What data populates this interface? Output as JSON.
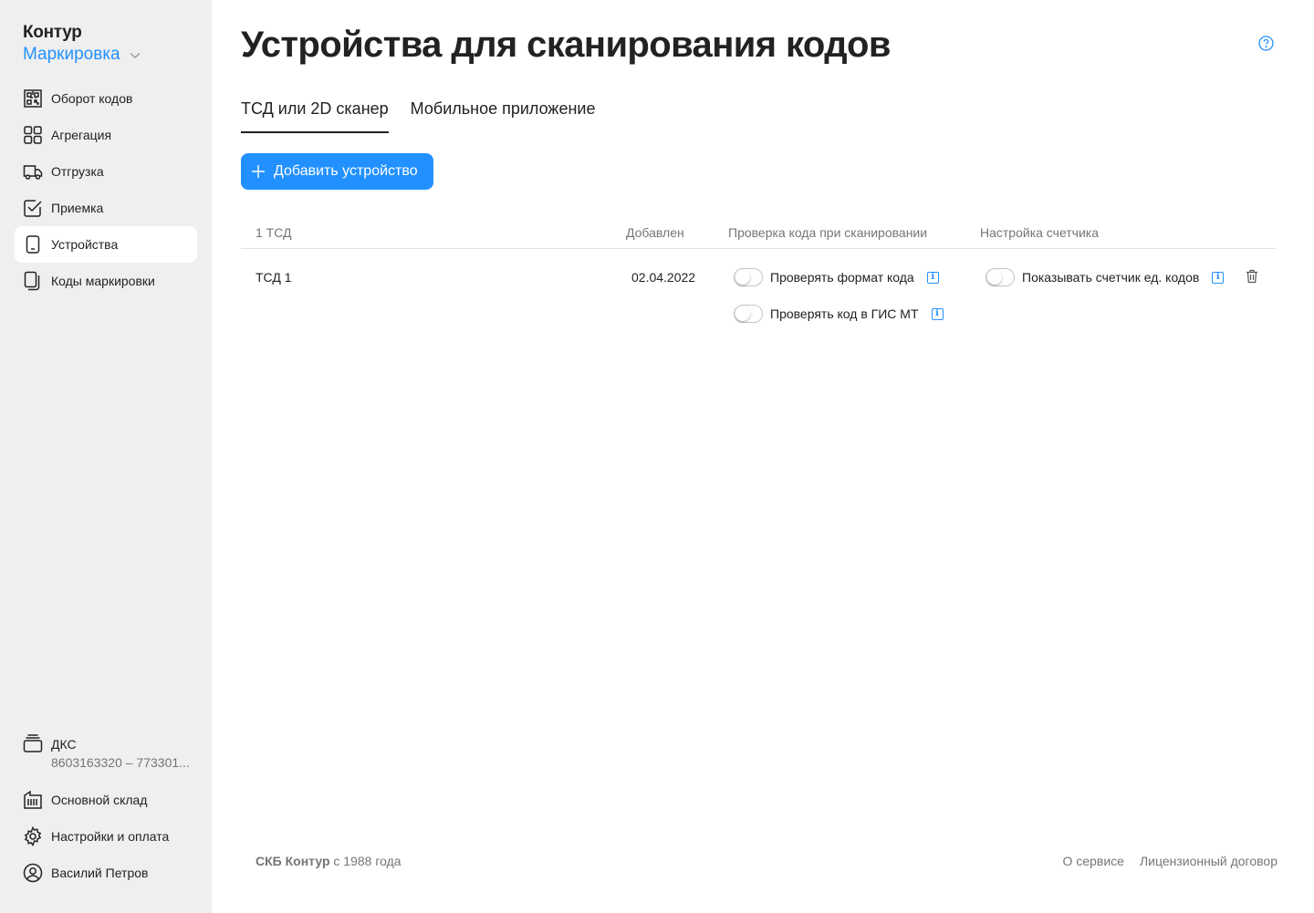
{
  "brand": {
    "top": "Контур",
    "product": "Маркировка"
  },
  "sidebar": {
    "items": [
      {
        "label": "Оборот кодов",
        "icon": "qr-code-icon"
      },
      {
        "label": "Агрегация",
        "icon": "grid-icon"
      },
      {
        "label": "Отгрузка",
        "icon": "truck-icon"
      },
      {
        "label": "Приемка",
        "icon": "checkbox-icon"
      },
      {
        "label": "Устройства",
        "icon": "device-icon",
        "active": true
      },
      {
        "label": "Коды маркировки",
        "icon": "copy-icon"
      }
    ],
    "org": {
      "name": "ДКС",
      "inn": "8603163320 – 773301..."
    },
    "bottom": [
      {
        "label": "Основной склад",
        "icon": "warehouse-icon"
      },
      {
        "label": "Настройки и оплата",
        "icon": "gear-icon"
      },
      {
        "label": "Василий Петров",
        "icon": "user-icon"
      }
    ]
  },
  "main": {
    "title": "Устройства для сканирования кодов",
    "tabs": [
      {
        "label": "ТСД или 2D сканер",
        "active": true
      },
      {
        "label": "Мобильное приложение",
        "active": false
      }
    ],
    "add_button": "Добавить устройство",
    "table": {
      "headers": {
        "name": "1 ТСД",
        "added": "Добавлен",
        "check": "Проверка кода при сканировании",
        "counter": "Настройка счетчика"
      },
      "rows": [
        {
          "name": "ТСД 1",
          "added": "02.04.2022",
          "check_format": "Проверять формат кода",
          "check_gis": "Проверять код в ГИС МТ",
          "show_counter": "Показывать счетчик ед. кодов"
        }
      ]
    }
  },
  "footer": {
    "company": "СКБ Контур",
    "since": " с 1988 года",
    "links": [
      "О сервисе",
      "Лицензионный договор"
    ]
  },
  "colors": {
    "accent": "#2291ff",
    "sidebar_bg": "#efefef"
  }
}
